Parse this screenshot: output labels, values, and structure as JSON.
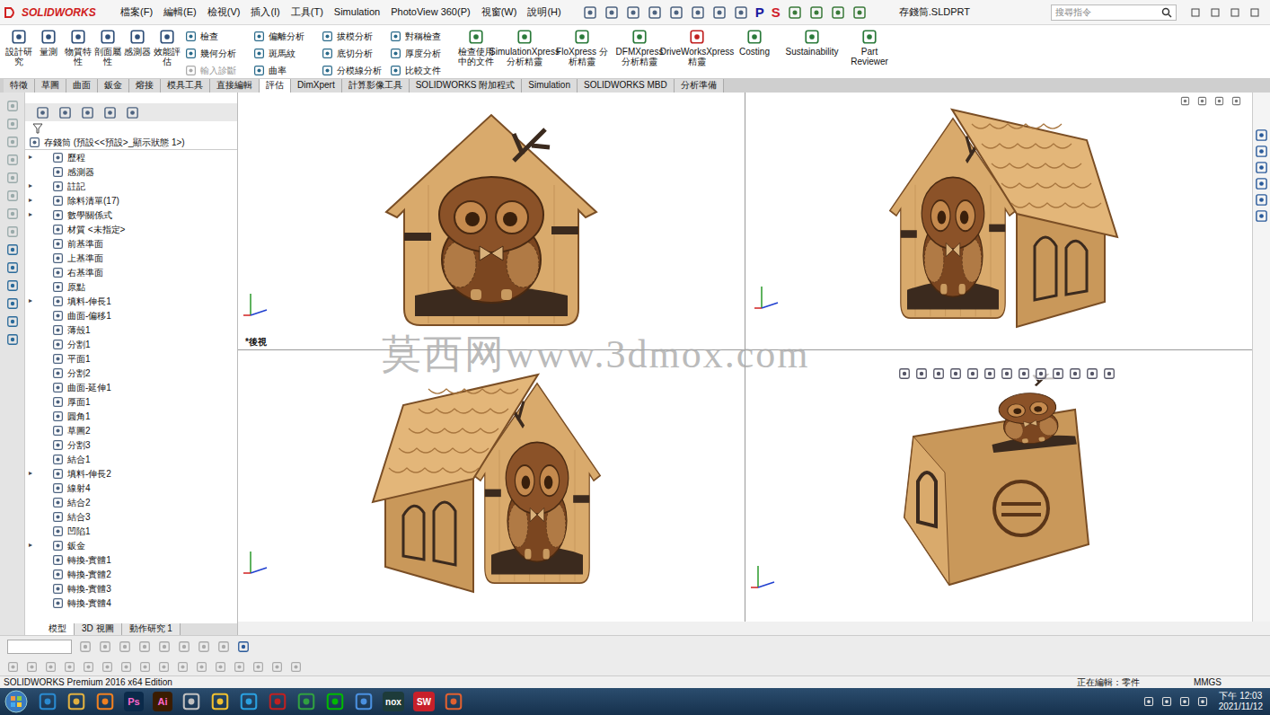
{
  "app": {
    "logo": "SOLIDWORKS",
    "title": "存錢筒.SLDPRT",
    "search_placeholder": "搜尋指令",
    "toolbar_letters": [
      {
        "label": "P",
        "color": "#1a1aa0"
      },
      {
        "label": "S",
        "color": "#d0202a"
      }
    ]
  },
  "menu": [
    "檔案(F)",
    "編輯(E)",
    "檢視(V)",
    "插入(I)",
    "工具(T)",
    "Simulation",
    "PhotoView 360(P)",
    "視窗(W)",
    "說明(H)"
  ],
  "ribbon": {
    "large_left": [
      {
        "label": "設計研究",
        "disabled": false
      },
      {
        "label": "量測",
        "disabled": false
      },
      {
        "label": "物質特性",
        "disabled": false
      },
      {
        "label": "剖面屬性",
        "disabled": false
      },
      {
        "label": "感測器",
        "disabled": false
      },
      {
        "label": "效能評估",
        "disabled": false
      }
    ],
    "small_columns": [
      [
        {
          "label": "檢查",
          "disabled": false
        },
        {
          "label": "幾何分析",
          "disabled": false
        },
        {
          "label": "輸入診斷",
          "disabled": true
        }
      ],
      [
        {
          "label": "偏離分析",
          "disabled": false
        },
        {
          "label": "斑馬紋",
          "disabled": false
        },
        {
          "label": "曲率",
          "disabled": false
        }
      ],
      [
        {
          "label": "拔模分析",
          "disabled": false
        },
        {
          "label": "底切分析",
          "disabled": false
        },
        {
          "label": "分模線分析",
          "disabled": false
        }
      ],
      [
        {
          "label": "對稱檢查",
          "disabled": false
        },
        {
          "label": "厚度分析",
          "disabled": false
        },
        {
          "label": "比較文件",
          "disabled": false
        }
      ]
    ],
    "large_right": [
      {
        "label": "檢查使用中的文件",
        "disabled": false
      },
      {
        "label": "SimulationXpress 分析精靈",
        "disabled": false
      },
      {
        "label": "FloXpress 分析精靈",
        "disabled": false
      },
      {
        "label": "DFMXpress 分析精靈",
        "disabled": false
      },
      {
        "label": "DriveWorksXpress 精靈",
        "disabled": false
      },
      {
        "label": "Costing",
        "disabled": false
      },
      {
        "label": "Sustainability",
        "disabled": false
      },
      {
        "label": "Part Reviewer",
        "disabled": false
      }
    ]
  },
  "tabs": [
    {
      "label": "特徵",
      "selected": false
    },
    {
      "label": "草圖",
      "selected": false
    },
    {
      "label": "曲面",
      "selected": false
    },
    {
      "label": "鈑金",
      "selected": false
    },
    {
      "label": "熔接",
      "selected": false
    },
    {
      "label": "模具工具",
      "selected": false
    },
    {
      "label": "直接編輯",
      "selected": false
    },
    {
      "label": "評估",
      "selected": true
    },
    {
      "label": "DimXpert",
      "selected": false
    },
    {
      "label": "計算影像工具",
      "selected": false
    },
    {
      "label": "SOLIDWORKS 附加程式",
      "selected": false
    },
    {
      "label": "Simulation",
      "selected": false
    },
    {
      "label": "SOLIDWORKS MBD",
      "selected": false
    },
    {
      "label": "分析準備",
      "selected": false
    }
  ],
  "feature_tree": {
    "root": "存錢筒 (預設<<預設>_顯示狀態 1>)",
    "items": [
      {
        "label": "歷程",
        "expandable": true
      },
      {
        "label": "感測器",
        "expandable": false
      },
      {
        "label": "註記",
        "expandable": true
      },
      {
        "label": "除料清單(17)",
        "expandable": true
      },
      {
        "label": "數學關係式",
        "expandable": true
      },
      {
        "label": "材質 <未指定>",
        "expandable": false
      },
      {
        "label": "前基準面",
        "expandable": false
      },
      {
        "label": "上基準面",
        "expandable": false
      },
      {
        "label": "右基準面",
        "expandable": false
      },
      {
        "label": "原點",
        "expandable": false
      },
      {
        "label": "填料-伸長1",
        "expandable": true
      },
      {
        "label": "曲面-偏移1",
        "expandable": false
      },
      {
        "label": "薄殼1",
        "expandable": false
      },
      {
        "label": "分割1",
        "expandable": false
      },
      {
        "label": "平面1",
        "expandable": false
      },
      {
        "label": "分割2",
        "expandable": false
      },
      {
        "label": "曲面-延伸1",
        "expandable": false
      },
      {
        "label": "厚面1",
        "expandable": false
      },
      {
        "label": "圓角1",
        "expandable": false
      },
      {
        "label": "草圖2",
        "expandable": false
      },
      {
        "label": "分割3",
        "expandable": false
      },
      {
        "label": "結合1",
        "expandable": false
      },
      {
        "label": "填料-伸長2",
        "expandable": true
      },
      {
        "label": "線射4",
        "expandable": false
      },
      {
        "label": "結合2",
        "expandable": false
      },
      {
        "label": "結合3",
        "expandable": false
      },
      {
        "label": "凹陷1",
        "expandable": false
      },
      {
        "label": "鈑金",
        "expandable": true
      },
      {
        "label": "轉換-實體1",
        "expandable": false
      },
      {
        "label": "轉換-實體2",
        "expandable": false
      },
      {
        "label": "轉換-實體3",
        "expandable": false
      },
      {
        "label": "轉換-實體4",
        "expandable": false
      }
    ]
  },
  "bottom_tabs": [
    {
      "label": "模型",
      "selected": true
    },
    {
      "label": "3D 視圖",
      "selected": false
    },
    {
      "label": "動作研究 1",
      "selected": false
    }
  ],
  "viewport": {
    "view_label": "*後視",
    "watermark": "莫西网www.3dmox.com"
  },
  "status_bar": {
    "edition": "SOLIDWORKS Premium 2016 x64 Edition",
    "editing": "正在編輯：零件",
    "units": "MMGS"
  },
  "taskbar": {
    "apps": [
      {
        "label": "Ps",
        "color": "#0b2a4a"
      },
      {
        "label": "Ai",
        "color": "#3a1c00"
      },
      {
        "label": "nox",
        "color": "#1d3b3a"
      },
      {
        "label": "SW",
        "color": "#c8202a"
      }
    ],
    "time": "下午 12:03",
    "date": "2021/11/12"
  }
}
